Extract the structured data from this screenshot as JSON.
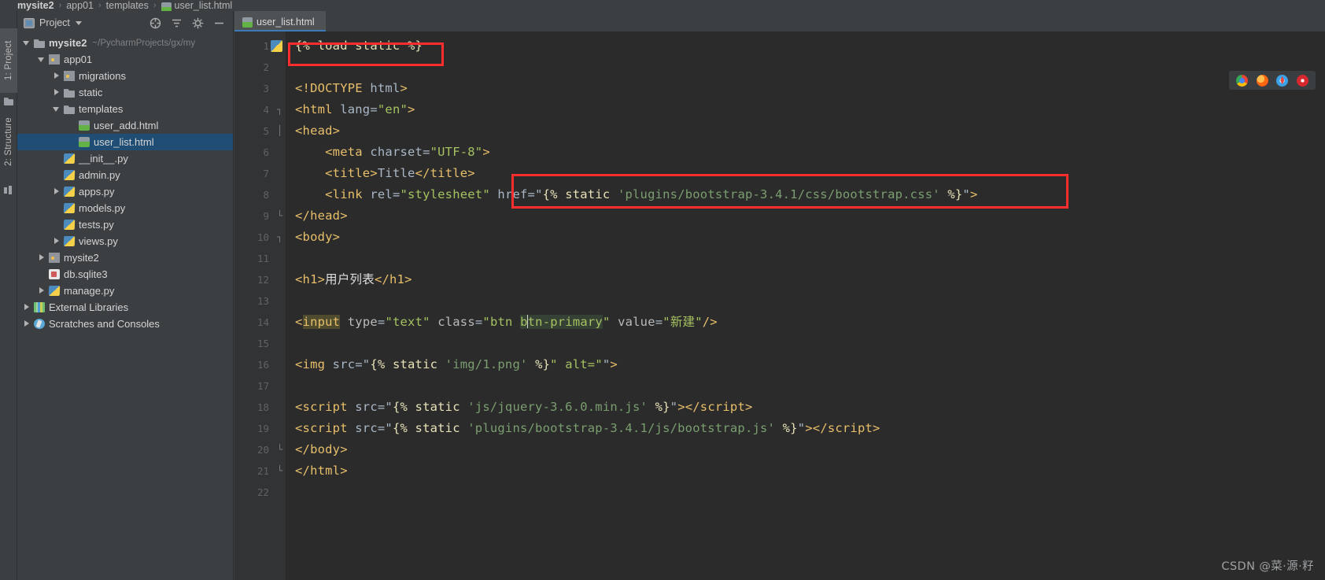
{
  "breadcrumb": {
    "items": [
      "mysite2",
      "app01",
      "templates",
      "user_list.html"
    ],
    "separator": "›"
  },
  "left_strip": {
    "project_tab": "1: Project",
    "structure_tab": "2: Structure"
  },
  "project_panel": {
    "title": "Project",
    "actions": [
      "collapse-all-icon",
      "sort-icon",
      "settings-gear-icon",
      "hide-icon"
    ],
    "tree": [
      {
        "label": "mysite2",
        "hint": "~/PycharmProjects/gx/my",
        "icon": "folder",
        "indent": 0,
        "arrow": "open",
        "bold": true,
        "selected": false
      },
      {
        "label": "app01",
        "hint": "",
        "icon": "folder-src",
        "indent": 1,
        "arrow": "open",
        "bold": false,
        "selected": false
      },
      {
        "label": "migrations",
        "hint": "",
        "icon": "folder-src",
        "indent": 2,
        "arrow": "closed",
        "bold": false,
        "selected": false
      },
      {
        "label": "static",
        "hint": "",
        "icon": "folder",
        "indent": 2,
        "arrow": "closed",
        "bold": false,
        "selected": false
      },
      {
        "label": "templates",
        "hint": "",
        "icon": "folder",
        "indent": 2,
        "arrow": "open",
        "bold": false,
        "selected": false
      },
      {
        "label": "user_add.html",
        "hint": "",
        "icon": "html",
        "indent": 3,
        "arrow": "none",
        "bold": false,
        "selected": false
      },
      {
        "label": "user_list.html",
        "hint": "",
        "icon": "html",
        "indent": 3,
        "arrow": "none",
        "bold": false,
        "selected": true
      },
      {
        "label": "__init__.py",
        "hint": "",
        "icon": "py",
        "indent": 2,
        "arrow": "none",
        "bold": false,
        "selected": false
      },
      {
        "label": "admin.py",
        "hint": "",
        "icon": "py",
        "indent": 2,
        "arrow": "none",
        "bold": false,
        "selected": false
      },
      {
        "label": "apps.py",
        "hint": "",
        "icon": "py",
        "indent": 2,
        "arrow": "closed",
        "bold": false,
        "selected": false
      },
      {
        "label": "models.py",
        "hint": "",
        "icon": "py",
        "indent": 2,
        "arrow": "none",
        "bold": false,
        "selected": false
      },
      {
        "label": "tests.py",
        "hint": "",
        "icon": "py",
        "indent": 2,
        "arrow": "none",
        "bold": false,
        "selected": false
      },
      {
        "label": "views.py",
        "hint": "",
        "icon": "py",
        "indent": 2,
        "arrow": "closed",
        "bold": false,
        "selected": false
      },
      {
        "label": "mysite2",
        "hint": "",
        "icon": "folder-src",
        "indent": 1,
        "arrow": "closed",
        "bold": false,
        "selected": false
      },
      {
        "label": "db.sqlite3",
        "hint": "",
        "icon": "db",
        "indent": 1,
        "arrow": "none",
        "bold": false,
        "selected": false
      },
      {
        "label": "manage.py",
        "hint": "",
        "icon": "py",
        "indent": 1,
        "arrow": "closed",
        "bold": false,
        "selected": false
      },
      {
        "label": "External Libraries",
        "hint": "",
        "icon": "lib",
        "indent": 0,
        "arrow": "closed",
        "bold": false,
        "selected": false
      },
      {
        "label": "Scratches and Consoles",
        "hint": "",
        "icon": "scratch",
        "indent": 0,
        "arrow": "closed",
        "bold": false,
        "selected": false
      }
    ]
  },
  "editor": {
    "tab_label": "user_list.html",
    "tab_icon": "html-file-icon",
    "gutter_lines": [
      "1",
      "2",
      "3",
      "4",
      "5",
      "6",
      "7",
      "8",
      "9",
      "10",
      "11",
      "12",
      "13",
      "14",
      "15",
      "16",
      "17",
      "18",
      "19",
      "20",
      "21",
      "22"
    ],
    "code_lines": [
      {
        "n": 1,
        "text": "{% load static %}"
      },
      {
        "n": 2,
        "text": ""
      },
      {
        "n": 3,
        "text": "<!DOCTYPE html>"
      },
      {
        "n": 4,
        "text": "<html lang=\"en\">"
      },
      {
        "n": 5,
        "text": "<head>"
      },
      {
        "n": 6,
        "text": "    <meta charset=\"UTF-8\">"
      },
      {
        "n": 7,
        "text": "    <title>Title</title>"
      },
      {
        "n": 8,
        "text": "    <link rel=\"stylesheet\" href=\"{% static 'plugins/bootstrap-3.4.1/css/bootstrap.css' %}\">"
      },
      {
        "n": 9,
        "text": "</head>"
      },
      {
        "n": 10,
        "text": "<body>"
      },
      {
        "n": 11,
        "text": ""
      },
      {
        "n": 12,
        "text": "<h1>用户列表</h1>"
      },
      {
        "n": 13,
        "text": ""
      },
      {
        "n": 14,
        "text": "<input type=\"text\" class=\"btn btn-primary\" value=\"新建\"/>"
      },
      {
        "n": 15,
        "text": ""
      },
      {
        "n": 16,
        "text": "<img src=\"{% static 'img/1.png' %}\" alt=\"\">"
      },
      {
        "n": 17,
        "text": ""
      },
      {
        "n": 18,
        "text": "<script src=\"{% static 'js/jquery-3.6.0.min.js' %}\"></script>"
      },
      {
        "n": 19,
        "text": "<script src=\"{% static 'plugins/bootstrap-3.4.1/js/bootstrap.js' %}\"></script>"
      },
      {
        "n": 20,
        "text": "</body>"
      },
      {
        "n": 21,
        "text": "</html>"
      },
      {
        "n": 22,
        "text": ""
      }
    ],
    "annotations": [
      {
        "name": "load-static-highlight",
        "target_line": 1,
        "color": "#ff2d2d"
      },
      {
        "name": "static-href-highlight",
        "target_line": 8,
        "color": "#ff2d2d"
      }
    ]
  },
  "browser_bar": {
    "icons": [
      "chrome-icon",
      "firefox-icon",
      "safari-icon",
      "opera-icon"
    ]
  },
  "watermark": {
    "text": "CSDN @菜·源·籽"
  },
  "colors": {
    "background": "#2b2b2b",
    "panel": "#3c3f41",
    "selection": "#1f4d73",
    "annotation": "#ff2d2d",
    "tag": "#e8bf6a",
    "string": "#a5c261"
  }
}
